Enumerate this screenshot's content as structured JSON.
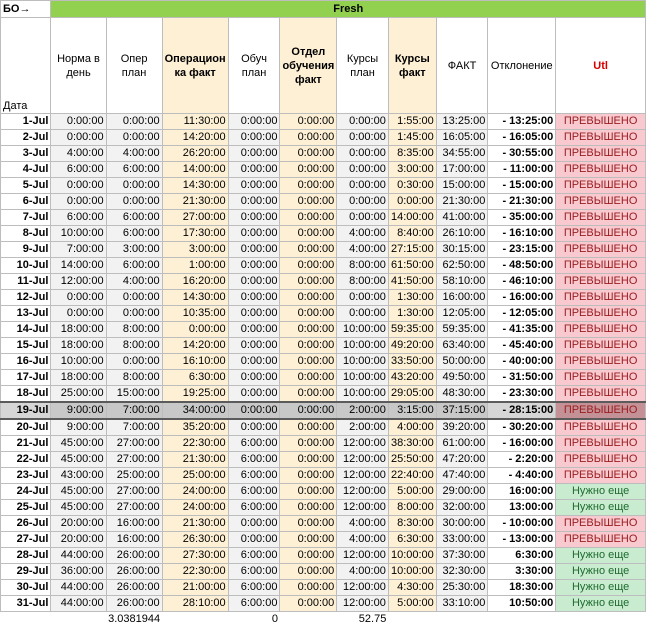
{
  "corner": "БО→",
  "group_title": "Fresh",
  "headers": {
    "date": "Дата",
    "norm": "Норма в день",
    "oper_plan": "Опер план",
    "oper_fact": "Операцион ка факт",
    "train_plan": "Обуч план",
    "train_dept": "Отдел обучения факт",
    "course_plan": "Курсы план",
    "course_fact": "Курсы факт",
    "fact": "ФАКТ",
    "dev": "Отклонение",
    "util": "Utl"
  },
  "rows": [
    {
      "d": "1-Jul",
      "n": "0:00:00",
      "op": "0:00:00",
      "of": "11:30:00",
      "tp": "0:00:00",
      "td": "0:00:00",
      "cp": "0:00:00",
      "cf": "1:55:00",
      "f": "13:25:00",
      "dv": "- 13:25:00",
      "u": "ПРЕВЫШЕНО",
      "s": "over"
    },
    {
      "d": "2-Jul",
      "n": "0:00:00",
      "op": "0:00:00",
      "of": "14:20:00",
      "tp": "0:00:00",
      "td": "0:00:00",
      "cp": "0:00:00",
      "cf": "1:45:00",
      "f": "16:05:00",
      "dv": "- 16:05:00",
      "u": "ПРЕВЫШЕНО",
      "s": "over"
    },
    {
      "d": "3-Jul",
      "n": "4:00:00",
      "op": "4:00:00",
      "of": "26:20:00",
      "tp": "0:00:00",
      "td": "0:00:00",
      "cp": "0:00:00",
      "cf": "8:35:00",
      "f": "34:55:00",
      "dv": "- 30:55:00",
      "u": "ПРЕВЫШЕНО",
      "s": "over"
    },
    {
      "d": "4-Jul",
      "n": "6:00:00",
      "op": "6:00:00",
      "of": "14:00:00",
      "tp": "0:00:00",
      "td": "0:00:00",
      "cp": "0:00:00",
      "cf": "3:00:00",
      "f": "17:00:00",
      "dv": "- 11:00:00",
      "u": "ПРЕВЫШЕНО",
      "s": "over"
    },
    {
      "d": "5-Jul",
      "n": "0:00:00",
      "op": "0:00:00",
      "of": "14:30:00",
      "tp": "0:00:00",
      "td": "0:00:00",
      "cp": "0:00:00",
      "cf": "0:30:00",
      "f": "15:00:00",
      "dv": "- 15:00:00",
      "u": "ПРЕВЫШЕНО",
      "s": "over"
    },
    {
      "d": "6-Jul",
      "n": "0:00:00",
      "op": "0:00:00",
      "of": "21:30:00",
      "tp": "0:00:00",
      "td": "0:00:00",
      "cp": "0:00:00",
      "cf": "0:00:00",
      "f": "21:30:00",
      "dv": "- 21:30:00",
      "u": "ПРЕВЫШЕНО",
      "s": "over"
    },
    {
      "d": "7-Jul",
      "n": "6:00:00",
      "op": "6:00:00",
      "of": "27:00:00",
      "tp": "0:00:00",
      "td": "0:00:00",
      "cp": "0:00:00",
      "cf": "14:00:00",
      "f": "41:00:00",
      "dv": "- 35:00:00",
      "u": "ПРЕВЫШЕНО",
      "s": "over"
    },
    {
      "d": "8-Jul",
      "n": "10:00:00",
      "op": "6:00:00",
      "of": "17:30:00",
      "tp": "0:00:00",
      "td": "0:00:00",
      "cp": "4:00:00",
      "cf": "8:40:00",
      "f": "26:10:00",
      "dv": "- 16:10:00",
      "u": "ПРЕВЫШЕНО",
      "s": "over"
    },
    {
      "d": "9-Jul",
      "n": "7:00:00",
      "op": "3:00:00",
      "of": "3:00:00",
      "tp": "0:00:00",
      "td": "0:00:00",
      "cp": "4:00:00",
      "cf": "27:15:00",
      "f": "30:15:00",
      "dv": "- 23:15:00",
      "u": "ПРЕВЫШЕНО",
      "s": "over"
    },
    {
      "d": "10-Jul",
      "n": "14:00:00",
      "op": "6:00:00",
      "of": "1:00:00",
      "tp": "0:00:00",
      "td": "0:00:00",
      "cp": "8:00:00",
      "cf": "61:50:00",
      "f": "62:50:00",
      "dv": "- 48:50:00",
      "u": "ПРЕВЫШЕНО",
      "s": "over"
    },
    {
      "d": "11-Jul",
      "n": "12:00:00",
      "op": "4:00:00",
      "of": "16:20:00",
      "tp": "0:00:00",
      "td": "0:00:00",
      "cp": "8:00:00",
      "cf": "41:50:00",
      "f": "58:10:00",
      "dv": "- 46:10:00",
      "u": "ПРЕВЫШЕНО",
      "s": "over"
    },
    {
      "d": "12-Jul",
      "n": "0:00:00",
      "op": "0:00:00",
      "of": "14:30:00",
      "tp": "0:00:00",
      "td": "0:00:00",
      "cp": "0:00:00",
      "cf": "1:30:00",
      "f": "16:00:00",
      "dv": "- 16:00:00",
      "u": "ПРЕВЫШЕНО",
      "s": "over"
    },
    {
      "d": "13-Jul",
      "n": "0:00:00",
      "op": "0:00:00",
      "of": "10:35:00",
      "tp": "0:00:00",
      "td": "0:00:00",
      "cp": "0:00:00",
      "cf": "1:30:00",
      "f": "12:05:00",
      "dv": "- 12:05:00",
      "u": "ПРЕВЫШЕНО",
      "s": "over"
    },
    {
      "d": "14-Jul",
      "n": "18:00:00",
      "op": "8:00:00",
      "of": "0:00:00",
      "tp": "0:00:00",
      "td": "0:00:00",
      "cp": "10:00:00",
      "cf": "59:35:00",
      "f": "59:35:00",
      "dv": "- 41:35:00",
      "u": "ПРЕВЫШЕНО",
      "s": "over"
    },
    {
      "d": "15-Jul",
      "n": "18:00:00",
      "op": "8:00:00",
      "of": "14:20:00",
      "tp": "0:00:00",
      "td": "0:00:00",
      "cp": "10:00:00",
      "cf": "49:20:00",
      "f": "63:40:00",
      "dv": "- 45:40:00",
      "u": "ПРЕВЫШЕНО",
      "s": "over"
    },
    {
      "d": "16-Jul",
      "n": "10:00:00",
      "op": "0:00:00",
      "of": "16:10:00",
      "tp": "0:00:00",
      "td": "0:00:00",
      "cp": "10:00:00",
      "cf": "33:50:00",
      "f": "50:00:00",
      "dv": "- 40:00:00",
      "u": "ПРЕВЫШЕНО",
      "s": "over"
    },
    {
      "d": "17-Jul",
      "n": "18:00:00",
      "op": "8:00:00",
      "of": "6:30:00",
      "tp": "0:00:00",
      "td": "0:00:00",
      "cp": "10:00:00",
      "cf": "43:20:00",
      "f": "49:50:00",
      "dv": "- 31:50:00",
      "u": "ПРЕВЫШЕНО",
      "s": "over"
    },
    {
      "d": "18-Jul",
      "n": "25:00:00",
      "op": "15:00:00",
      "of": "19:25:00",
      "tp": "0:00:00",
      "td": "0:00:00",
      "cp": "10:00:00",
      "cf": "29:05:00",
      "f": "48:30:00",
      "dv": "- 23:30:00",
      "u": "ПРЕВЫШЕНО",
      "s": "over"
    },
    {
      "d": "19-Jul",
      "n": "9:00:00",
      "op": "7:00:00",
      "of": "34:00:00",
      "tp": "0:00:00",
      "td": "0:00:00",
      "cp": "2:00:00",
      "cf": "3:15:00",
      "f": "37:15:00",
      "dv": "- 28:15:00",
      "u": "ПРЕВЫШЕНО",
      "s": "over",
      "sel": true
    },
    {
      "d": "20-Jul",
      "n": "9:00:00",
      "op": "7:00:00",
      "of": "35:20:00",
      "tp": "0:00:00",
      "td": "0:00:00",
      "cp": "2:00:00",
      "cf": "4:00:00",
      "f": "39:20:00",
      "dv": "- 30:20:00",
      "u": "ПРЕВЫШЕНО",
      "s": "over"
    },
    {
      "d": "21-Jul",
      "n": "45:00:00",
      "op": "27:00:00",
      "of": "22:30:00",
      "tp": "6:00:00",
      "td": "0:00:00",
      "cp": "12:00:00",
      "cf": "38:30:00",
      "f": "61:00:00",
      "dv": "- 16:00:00",
      "u": "ПРЕВЫШЕНО",
      "s": "over"
    },
    {
      "d": "22-Jul",
      "n": "45:00:00",
      "op": "27:00:00",
      "of": "21:30:00",
      "tp": "6:00:00",
      "td": "0:00:00",
      "cp": "12:00:00",
      "cf": "25:50:00",
      "f": "47:20:00",
      "dv": "- 2:20:00",
      "u": "ПРЕВЫШЕНО",
      "s": "over"
    },
    {
      "d": "23-Jul",
      "n": "43:00:00",
      "op": "25:00:00",
      "of": "25:00:00",
      "tp": "6:00:00",
      "td": "0:00:00",
      "cp": "12:00:00",
      "cf": "22:40:00",
      "f": "47:40:00",
      "dv": "- 4:40:00",
      "u": "ПРЕВЫШЕНО",
      "s": "over"
    },
    {
      "d": "24-Jul",
      "n": "45:00:00",
      "op": "27:00:00",
      "of": "24:00:00",
      "tp": "6:00:00",
      "td": "0:00:00",
      "cp": "12:00:00",
      "cf": "5:00:00",
      "f": "29:00:00",
      "dv": "16:00:00",
      "u": "Нужно еще",
      "s": "need"
    },
    {
      "d": "25-Jul",
      "n": "45:00:00",
      "op": "27:00:00",
      "of": "24:00:00",
      "tp": "6:00:00",
      "td": "0:00:00",
      "cp": "12:00:00",
      "cf": "8:00:00",
      "f": "32:00:00",
      "dv": "13:00:00",
      "u": "Нужно еще",
      "s": "need"
    },
    {
      "d": "26-Jul",
      "n": "20:00:00",
      "op": "16:00:00",
      "of": "21:30:00",
      "tp": "0:00:00",
      "td": "0:00:00",
      "cp": "4:00:00",
      "cf": "8:30:00",
      "f": "30:00:00",
      "dv": "- 10:00:00",
      "u": "ПРЕВЫШЕНО",
      "s": "over"
    },
    {
      "d": "27-Jul",
      "n": "20:00:00",
      "op": "16:00:00",
      "of": "26:30:00",
      "tp": "0:00:00",
      "td": "0:00:00",
      "cp": "4:00:00",
      "cf": "6:30:00",
      "f": "33:00:00",
      "dv": "- 13:00:00",
      "u": "ПРЕВЫШЕНО",
      "s": "over"
    },
    {
      "d": "28-Jul",
      "n": "44:00:00",
      "op": "26:00:00",
      "of": "27:30:00",
      "tp": "6:00:00",
      "td": "0:00:00",
      "cp": "12:00:00",
      "cf": "10:00:00",
      "f": "37:30:00",
      "dv": "6:30:00",
      "u": "Нужно еще",
      "s": "need"
    },
    {
      "d": "29-Jul",
      "n": "36:00:00",
      "op": "26:00:00",
      "of": "22:30:00",
      "tp": "6:00:00",
      "td": "0:00:00",
      "cp": "4:00:00",
      "cf": "10:00:00",
      "f": "32:30:00",
      "dv": "3:30:00",
      "u": "Нужно еще",
      "s": "need"
    },
    {
      "d": "30-Jul",
      "n": "44:00:00",
      "op": "26:00:00",
      "of": "21:00:00",
      "tp": "6:00:00",
      "td": "0:00:00",
      "cp": "12:00:00",
      "cf": "4:30:00",
      "f": "25:30:00",
      "dv": "18:30:00",
      "u": "Нужно еще",
      "s": "need"
    },
    {
      "d": "31-Jul",
      "n": "44:00:00",
      "op": "26:00:00",
      "of": "28:10:00",
      "tp": "6:00:00",
      "td": "0:00:00",
      "cp": "12:00:00",
      "cf": "5:00:00",
      "f": "33:10:00",
      "dv": "10:50:00",
      "u": "Нужно еще",
      "s": "need"
    }
  ],
  "footer": {
    "oper_plan": "3.0381944",
    "train_plan": "0",
    "course_plan": "52.75"
  }
}
